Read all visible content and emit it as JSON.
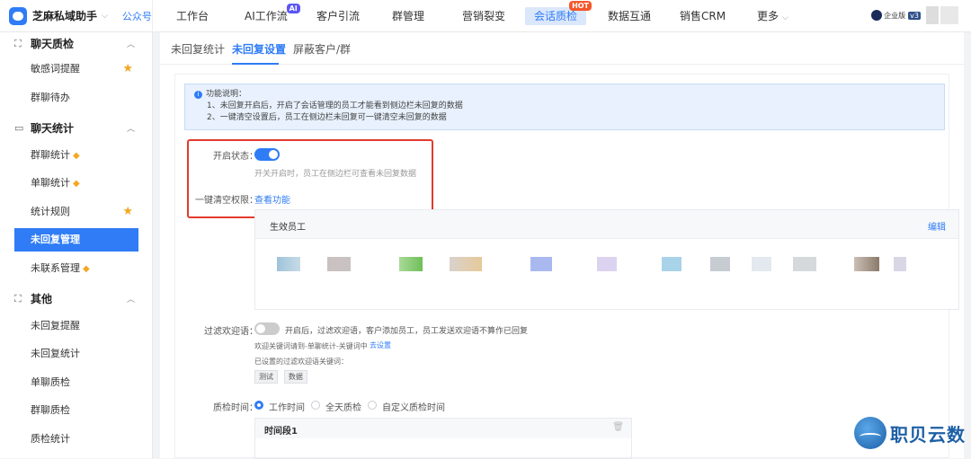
{
  "brand": {
    "name": "芝麻私域助手",
    "gzh": "公众号"
  },
  "nav": {
    "items": [
      {
        "label": "工作台"
      },
      {
        "label": "AI工作流",
        "badge": "AI"
      },
      {
        "label": "客户引流"
      },
      {
        "label": "群管理"
      },
      {
        "label": "营销裂变"
      },
      {
        "label": "会话质检",
        "badge": "HOT",
        "active": true
      },
      {
        "label": "数据互通"
      },
      {
        "label": "销售CRM"
      },
      {
        "label": "更多"
      }
    ]
  },
  "account": {
    "edition": "企业版",
    "version": "v3"
  },
  "sidebar": {
    "groups": [
      {
        "title": "聊天质检",
        "items": [
          "敏感词提醒",
          "群聊待办"
        ]
      },
      {
        "title": "聊天统计",
        "items": [
          "群聊统计",
          "单聊统计",
          "统计规则",
          "未回复管理",
          "未联系管理"
        ]
      },
      {
        "title": "其他",
        "items": [
          "未回复提醒",
          "未回复统计",
          "单聊质检",
          "群聊质检",
          "质检统计"
        ]
      }
    ],
    "active_item": "未回复管理"
  },
  "tabs": [
    "未回复统计",
    "未回复设置",
    "屏蔽客户/群"
  ],
  "active_tab": "未回复设置",
  "info": {
    "title": "功能说明：",
    "lines": [
      "1、未回复开启后，开启了会话管理的员工才能看到侧边栏未回复的数据",
      "2、一键清空设置后，员工在侧边栏未回复可一键清空未回复的数据"
    ]
  },
  "settings": {
    "status_label": "开启状态：",
    "status_on": true,
    "status_hint": "开关开启时，员工在侧边栏可查看未回复数据",
    "clear_label": "一键清空权限：",
    "clear_link": "查看功能",
    "staff_title": "生效员工",
    "staff_edit": "编辑",
    "filter_label": "过滤欢迎语：",
    "filter_on": false,
    "filter_hint": "开启后，过滤欢迎语，客户添加员工，员工发送欢迎语不算作已回复",
    "filter_keyword_note": "欢迎关键词请到-单聊统计-关键词中",
    "filter_keyword_link": "去设置",
    "filter_set_label": "已设置的过滤欢迎语关键词：",
    "keywords": [
      "测试",
      "数据"
    ],
    "qc_label": "质检时间：",
    "qc_options": [
      "工作时间",
      "全天质检",
      "自定义质检时间"
    ],
    "qc_selected": "工作时间",
    "period_title": "时间段1"
  },
  "watermark": "职贝云数"
}
